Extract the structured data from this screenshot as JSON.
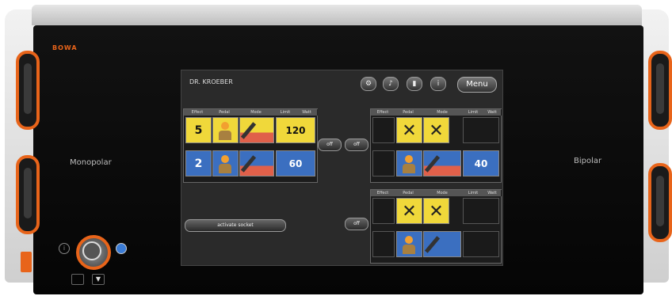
{
  "device": {
    "left_label": "Monopolar",
    "right_label": "Bipolar",
    "brand_text": "BOWA"
  },
  "screen": {
    "title": "DR. KROEBER",
    "menu_label": "Menu",
    "toolbar_icons": [
      "gear-icon",
      "speaker-icon",
      "trash-icon",
      "info-icon"
    ]
  },
  "left_panel": {
    "headers": [
      "Effect",
      "Pedal",
      "Mode",
      "Limit",
      "Watt"
    ],
    "row1": {
      "effect": "5",
      "watt": "120"
    },
    "row2": {
      "effect": "2",
      "watt": "60"
    }
  },
  "mid_buttons": {
    "off_1": "off",
    "off_2": "off",
    "off_3": "off"
  },
  "right_top_panel": {
    "headers": [
      "Effect",
      "Pedal",
      "Mode",
      "Limit",
      "Watt"
    ],
    "watt": "40"
  },
  "right_bottom_panel": {
    "headers": [
      "Effect",
      "Pedal",
      "Mode",
      "Limit",
      "Watt"
    ]
  },
  "activate_socket_label": "activate socket"
}
